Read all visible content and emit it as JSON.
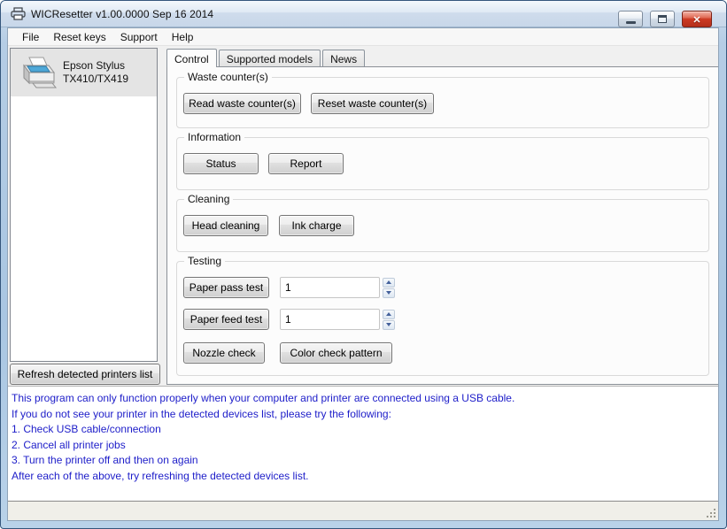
{
  "window": {
    "title": "WICResetter v1.00.0000 Sep 16 2014"
  },
  "menu": {
    "items": [
      "File",
      "Reset keys",
      "Support",
      "Help"
    ]
  },
  "printer_list": {
    "selected_printer": {
      "line1": "Epson Stylus",
      "line2": "TX410/TX419"
    },
    "refresh_button": "Refresh detected printers list"
  },
  "tabs": [
    {
      "label": "Control",
      "active": true
    },
    {
      "label": "Supported models",
      "active": false
    },
    {
      "label": "News",
      "active": false
    }
  ],
  "control_tab": {
    "groups": [
      {
        "title": "Waste counter(s)",
        "buttons": [
          "Read waste counter(s)",
          "Reset waste counter(s)"
        ]
      },
      {
        "title": "Information",
        "buttons": [
          "Status",
          "Report"
        ]
      },
      {
        "title": "Cleaning",
        "buttons": [
          "Head cleaning",
          "Ink charge"
        ]
      },
      {
        "title": "Testing",
        "buttons": [
          "Paper pass test",
          "Paper feed test",
          "Nozzle check",
          "Color check pattern"
        ],
        "spin_values": {
          "paper_pass": "1",
          "paper_feed": "1"
        }
      }
    ]
  },
  "info": {
    "lines": [
      "This program can only function properly when your computer and printer are connected using a USB cable.",
      "If you do not see your printer in the detected devices list, please try the following:",
      "1. Check USB cable/connection",
      "2. Cancel all printer jobs",
      "3. Turn the printer off and then on again",
      "After each of the above, try refreshing the detected devices list."
    ]
  },
  "icons": {
    "titlebar": "printer-icon",
    "list": "printer-device-icon",
    "window_controls": [
      "minimize-icon",
      "restore-icon",
      "close-icon"
    ],
    "spinner": [
      "spin-up-icon",
      "spin-down-icon"
    ],
    "statusbar": "resize-grip-icon"
  },
  "colors": {
    "frame_blue": "#a9c6e2",
    "info_text_blue": "#1d1dc9",
    "close_button_red": "#cc3a23",
    "client_bg": "#f0f0f0",
    "tabpage_bg": "#fcfcfc"
  }
}
